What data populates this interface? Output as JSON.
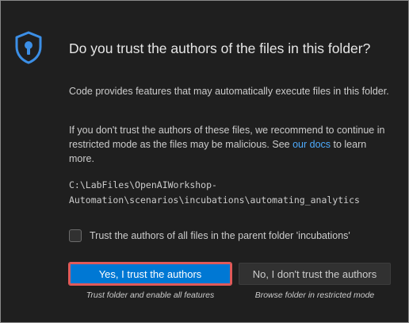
{
  "dialog": {
    "icon": "shield-lock-icon",
    "title": "Do you trust the authors of the files in this folder?",
    "paragraph1": "Code provides features that may automatically execute files in this folder.",
    "paragraph2_text": "If you don't trust the authors of these files, we recommend to continue in restricted mode as the files may be malicious. See ",
    "paragraph2_link": "our docs",
    "paragraph2_suffix": " to learn more.",
    "path_line1": "C:\\LabFiles\\OpenAIWorkshop-",
    "path_line2": "Automation\\scenarios\\incubations\\automating_analytics",
    "checkbox_label": "Trust the authors of all files in the parent folder 'incubations'",
    "checkbox_checked": false,
    "trust_button_label": "Yes, I trust the authors",
    "trust_button_caption": "Trust folder and enable all features",
    "restricted_button_label": "No, I don't trust the authors",
    "restricted_button_caption": "Browse folder in restricted mode"
  },
  "colors": {
    "background": "#1f1f1f",
    "accent": "#0078d4",
    "link": "#4daafc",
    "highlight_border": "#e05a5a"
  }
}
